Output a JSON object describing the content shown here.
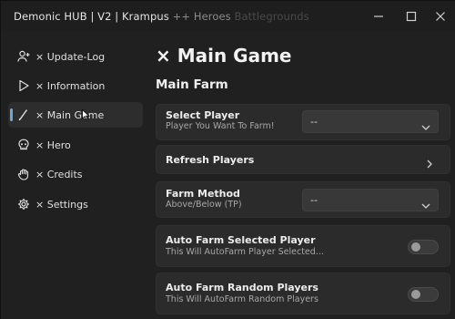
{
  "window": {
    "title_main": "Demonic HUB | V2 | Krampus",
    "title_tag": "++ Heroes",
    "title_faint": "Battlegrounds",
    "controls": {
      "minimize": "minimize-icon",
      "maximize": "maximize-icon",
      "close": "close-icon"
    }
  },
  "sidebar": {
    "items": [
      {
        "label": "× Update-Log",
        "icon": "user-plus-icon"
      },
      {
        "label": "× Information",
        "icon": "play-icon"
      },
      {
        "label": "× Main Game",
        "icon": "pen-icon",
        "active": true
      },
      {
        "label": "× Hero",
        "icon": "skull-icon"
      },
      {
        "label": "× Credits",
        "icon": "hand-icon"
      },
      {
        "label": "× Settings",
        "icon": "gear-icon"
      }
    ],
    "accent": "#6fa6d8"
  },
  "main": {
    "page_title": "× Main Game",
    "section_title": "Main Farm",
    "select_player": {
      "title": "Select Player",
      "subtitle": "Player You Want To Farm!",
      "value": "--"
    },
    "refresh_players": {
      "title": "Refresh Players"
    },
    "farm_method": {
      "title": "Farm Method",
      "subtitle": "Above/Below (TP)",
      "value": "--"
    },
    "auto_farm_selected": {
      "title": "Auto Farm Selected Player",
      "subtitle": "This Will AutoFarm Player Selected...",
      "enabled": false
    },
    "auto_farm_random": {
      "title": "Auto Farm Random Players",
      "subtitle": "This Will AutoFarm Random Players",
      "enabled": false
    }
  }
}
